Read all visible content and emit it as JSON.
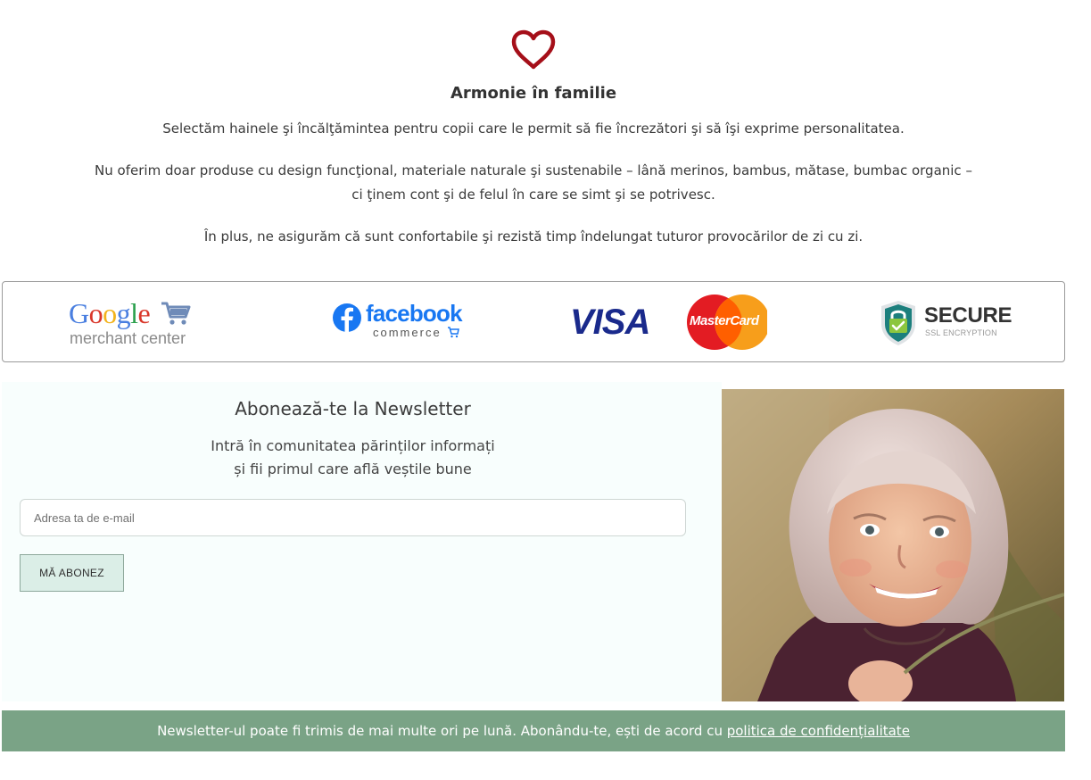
{
  "intro": {
    "icon": "heart-icon",
    "icon_color": "#a50f19",
    "title": "Armonie în familie",
    "paragraph1": "Selectăm hainele şi încălţămintea pentru copii care le permit să fie încrezători şi să îşi exprime personalitatea.",
    "paragraph2_line1": "Nu oferim doar produse cu design funcţional, materiale naturale şi sustenabile – lână merinos, bambus, mătase, bumbac organic –",
    "paragraph2_line2": "ci ţinem cont şi de felul în care se simt şi se potrivesc.",
    "paragraph3": "În plus, ne asigurăm că sunt confortabile şi rezistă timp îndelungat tuturor provocărilor de zi cu zi."
  },
  "trust_badges": {
    "google": {
      "brand": "Google",
      "caption": "merchant center",
      "icon": "shopping-cart-icon"
    },
    "facebook": {
      "brand": "facebook",
      "caption": "commerce",
      "icon": "facebook-icon"
    },
    "visa": {
      "brand": "VISA",
      "color": "#1a2a8c"
    },
    "mastercard": {
      "brand": "MasterCard"
    },
    "secure": {
      "title": "SECURE",
      "caption": "SSL ENCRYPTION",
      "icon": "shield-lock-icon"
    }
  },
  "newsletter": {
    "title": "Abonează-te la Newsletter",
    "subtitle_line1": "Intră în comunitatea părinților informați",
    "subtitle_line2": "și fii primul care află veștile bune",
    "email_placeholder": "Adresa ta de e-mail",
    "subscribe_label": "MĂ ABONEZ",
    "panel_color": "#f8fefd",
    "button_color": "#dbeee7"
  },
  "footer": {
    "text": "Newsletter-ul poate fi trimis de mai multe ori pe lună. Abonându-te, ești de acord cu ",
    "link_label": "politica de confidențialitate",
    "bar_color": "#7aa386"
  }
}
